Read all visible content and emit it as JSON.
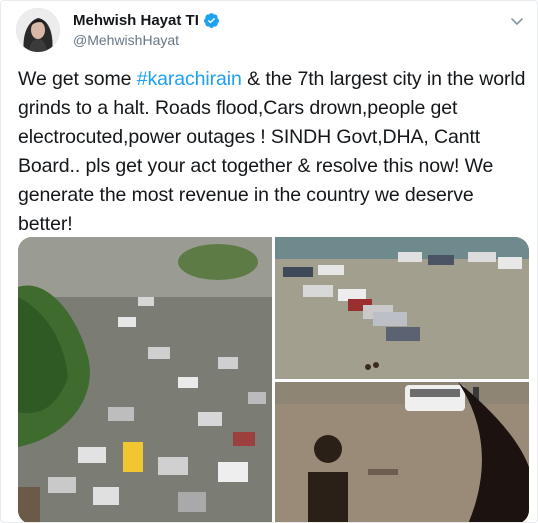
{
  "author": {
    "name": "Mehwish Hayat TI",
    "handle": "@MehwishHayat",
    "verified_icon": "verified-badge-icon",
    "accent_color": "#1da1f2"
  },
  "menu": {
    "icon": "chevron-down-icon"
  },
  "tweet": {
    "text_before": "We get some ",
    "hashtag": "#karachirain",
    "text_after": " & the 7th largest city in the world grinds to a halt. Roads flood,Cars drown,people get electrocuted,power outages ! SINDH Govt,DHA, Cantt Board.. pls get your act together & resolve this now! We generate the most revenue in the country we deserve better!"
  },
  "media": {
    "count": 3,
    "items": [
      {
        "description": "traffic-jam-photo"
      },
      {
        "description": "flooded-parking-photo"
      },
      {
        "description": "flooded-street-photo"
      }
    ]
  }
}
